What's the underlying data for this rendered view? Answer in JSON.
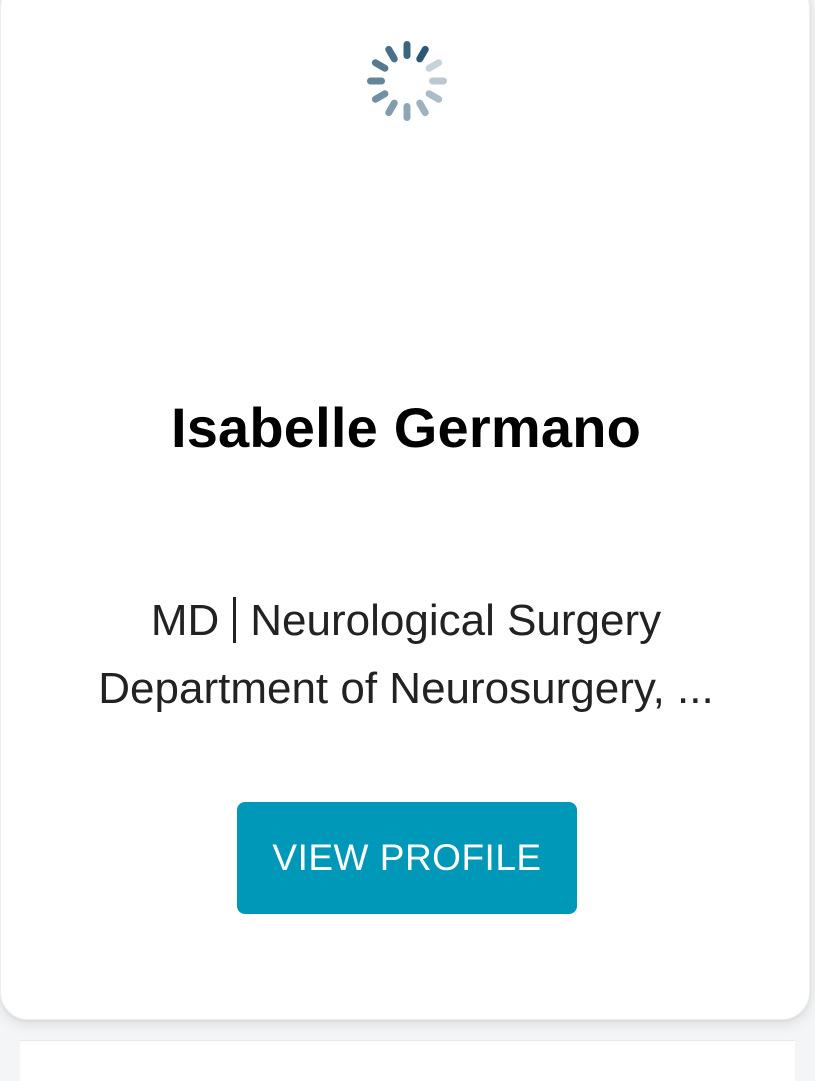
{
  "card": {
    "loading_icon": "spinner-icon",
    "name": "Isabelle Germano",
    "degree": "MD",
    "specialty": "Neurological Surgery",
    "department": "Department of Neurosurgery, ...",
    "button_label": "VIEW PROFILE"
  },
  "colors": {
    "button": "#0098b9",
    "spinner": "#1f4e6e",
    "text": "#222222"
  }
}
